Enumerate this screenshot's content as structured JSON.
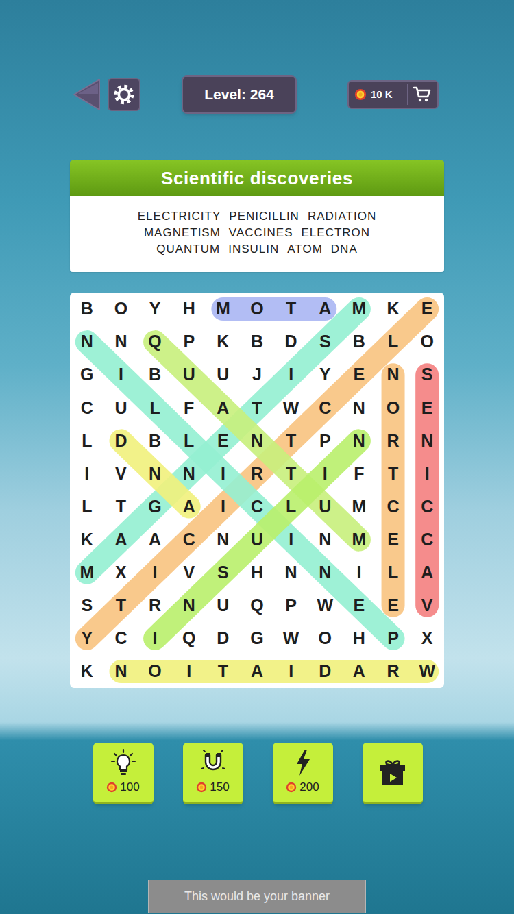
{
  "header": {
    "level": "Level: 264",
    "coins": "10 K"
  },
  "puzzle": {
    "title": "Scientific discoveries",
    "word_rows": [
      [
        "ELECTRICITY",
        "PENICILLIN",
        "RADIATION"
      ],
      [
        "MAGNETISM",
        "VACCINES",
        "ELECTRON"
      ],
      [
        "QUANTUM",
        "INSULIN",
        "ATOM",
        "DNA"
      ]
    ]
  },
  "grid": [
    [
      "B",
      "O",
      "Y",
      "H",
      "M",
      "O",
      "T",
      "A",
      "M",
      "K",
      "E"
    ],
    [
      "N",
      "N",
      "Q",
      "P",
      "K",
      "B",
      "D",
      "S",
      "B",
      "L",
      "O"
    ],
    [
      "G",
      "I",
      "B",
      "U",
      "U",
      "J",
      "I",
      "Y",
      "E",
      "N",
      "S"
    ],
    [
      "C",
      "U",
      "L",
      "F",
      "A",
      "T",
      "W",
      "C",
      "N",
      "O",
      "E"
    ],
    [
      "L",
      "D",
      "B",
      "L",
      "E",
      "N",
      "T",
      "P",
      "N",
      "R",
      "N"
    ],
    [
      "I",
      "V",
      "N",
      "N",
      "I",
      "R",
      "T",
      "I",
      "F",
      "T",
      "I"
    ],
    [
      "L",
      "T",
      "G",
      "A",
      "I",
      "C",
      "L",
      "U",
      "M",
      "C",
      "C"
    ],
    [
      "K",
      "A",
      "A",
      "C",
      "N",
      "U",
      "I",
      "N",
      "M",
      "E",
      "C"
    ],
    [
      "M",
      "X",
      "I",
      "V",
      "S",
      "H",
      "N",
      "N",
      "I",
      "L",
      "A"
    ],
    [
      "S",
      "T",
      "R",
      "N",
      "U",
      "Q",
      "P",
      "W",
      "E",
      "E",
      "V"
    ],
    [
      "Y",
      "C",
      "I",
      "Q",
      "D",
      "G",
      "W",
      "O",
      "H",
      "P",
      "X"
    ],
    [
      "K",
      "N",
      "O",
      "I",
      "T",
      "A",
      "I",
      "D",
      "A",
      "R",
      "W"
    ]
  ],
  "highlights": [
    {
      "from": [
        0,
        7
      ],
      "to": [
        0,
        4
      ],
      "color": "#aab6f3"
    },
    {
      "from": [
        0,
        10
      ],
      "to": [
        10,
        0
      ],
      "color": "#f8c37f"
    },
    {
      "from": [
        9,
        10
      ],
      "to": [
        2,
        10
      ],
      "color": "#f47f7f"
    },
    {
      "from": [
        9,
        9
      ],
      "to": [
        2,
        9
      ],
      "color": "#f8c37f"
    },
    {
      "from": [
        10,
        9
      ],
      "to": [
        1,
        0
      ],
      "color": "#94efd2"
    },
    {
      "from": [
        8,
        0
      ],
      "to": [
        0,
        8
      ],
      "color": "#94efd2"
    },
    {
      "from": [
        1,
        2
      ],
      "to": [
        7,
        8
      ],
      "color": "#c8f07c"
    },
    {
      "from": [
        10,
        2
      ],
      "to": [
        4,
        8
      ],
      "color": "#b9ef6c"
    },
    {
      "from": [
        4,
        1
      ],
      "to": [
        6,
        3
      ],
      "color": "#f1f17c"
    },
    {
      "from": [
        11,
        10
      ],
      "to": [
        11,
        1
      ],
      "color": "#f1f17c"
    }
  ],
  "powerups": [
    {
      "kind": "hint",
      "cost": "100"
    },
    {
      "kind": "magnet",
      "cost": "150"
    },
    {
      "kind": "lightning",
      "cost": "200"
    },
    {
      "kind": "video"
    }
  ],
  "banner": "This would be your banner"
}
